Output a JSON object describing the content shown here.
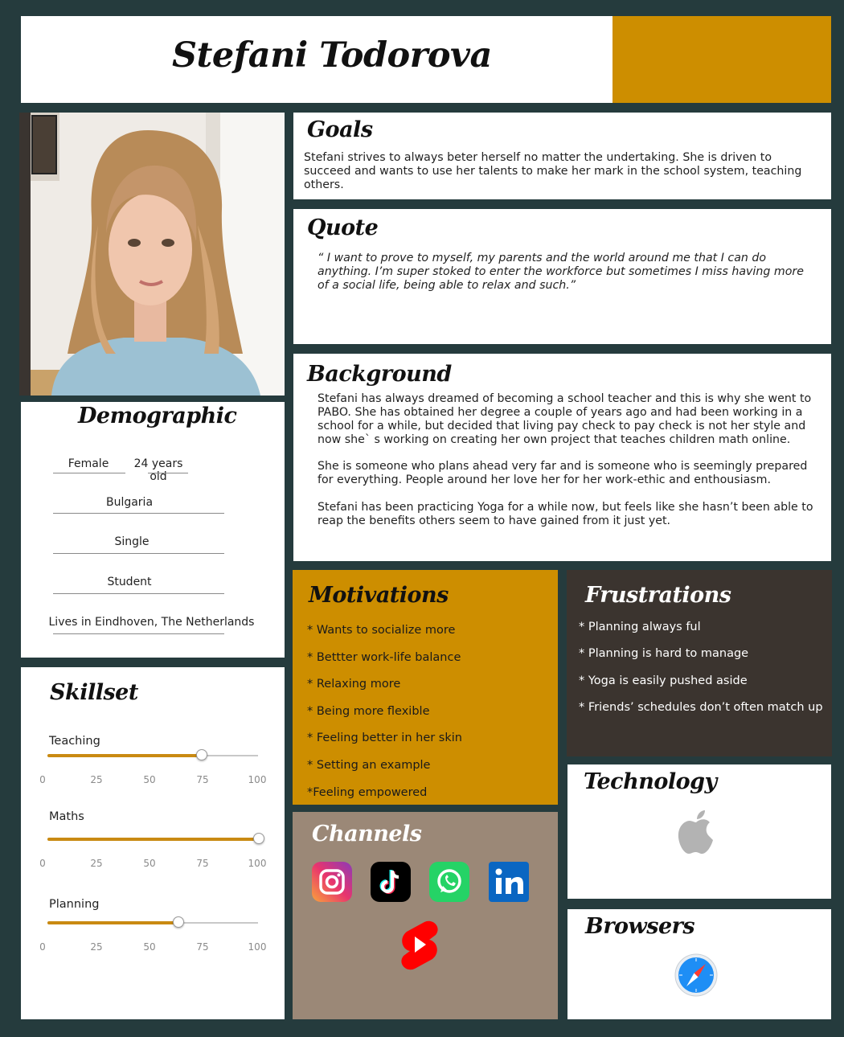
{
  "name": "Stefani Todorova",
  "colors": {
    "background": "#253b3d",
    "accent_gold": "#cd8e00",
    "frustrations_bg": "#3b342f",
    "channels_bg": "#9b8877",
    "slider_fill": "#c98a12"
  },
  "goals": {
    "title": "Goals",
    "text": "Stefani strives to always beter herself no matter the undertaking. She is driven to succeed and wants to use her talents to make her mark in the school system, teaching others."
  },
  "quote": {
    "title": "Quote",
    "text": "“ I want to prove to myself, my parents and the world around me that I can do anything. I’m super stoked to enter the workforce but sometimes I miss having more of a social life, being able to relax and such.”"
  },
  "background": {
    "title": "Background",
    "paragraphs": [
      "Stefani has always dreamed of becoming a school teacher and this is why she went to PABO. She has obtained her degree a couple of years ago and had been working in a school for a while, but decided that living pay check to pay check is not her style and now she` s working on creating her own project that teaches children math online.",
      "She is someone who plans ahead very far and is someone who is seemingly prepared for everything. People around her love her for her work-ethic and enthousiasm.",
      "Stefani has been practicing Yoga for a while now,  but feels like she hasn’t been able to reap the benefits others seem to have gained from it just yet."
    ]
  },
  "demographic": {
    "title": "Demographic",
    "gender": "Female",
    "age": "24 years old",
    "country": "Bulgaria",
    "relationship": "Single",
    "occupation": "Student",
    "location": "Lives in Eindhoven, The Netherlands"
  },
  "skillset": {
    "title": "Skillset",
    "scale": [
      "0",
      "25",
      "50",
      "75",
      "100"
    ],
    "skills": [
      {
        "label": "Teaching",
        "value": 73
      },
      {
        "label": "Maths",
        "value": 100
      },
      {
        "label": "Planning",
        "value": 62
      }
    ]
  },
  "motivations": {
    "title": "Motivations",
    "items": [
      "* Wants to socialize more",
      "* Bettter work-life balance",
      "* Relaxing more",
      "* Being more flexible",
      "* Feeling better in her skin",
      "* Setting an example",
      "*Feeling empowered"
    ]
  },
  "frustrations": {
    "title": "Frustrations",
    "items": [
      "* Planning always ful",
      "* Planning is hard to manage",
      "* Yoga is easily pushed aside",
      "* Friends’ schedules don’t often match up"
    ]
  },
  "channels": {
    "title": "Channels",
    "icons": [
      "instagram-icon",
      "tiktok-icon",
      "whatsapp-icon",
      "linkedin-icon",
      "youtube-shorts-icon"
    ]
  },
  "technology": {
    "title": "Technology",
    "icon": "apple-icon"
  },
  "browsers": {
    "title": "Browsers",
    "icon": "safari-icon"
  }
}
